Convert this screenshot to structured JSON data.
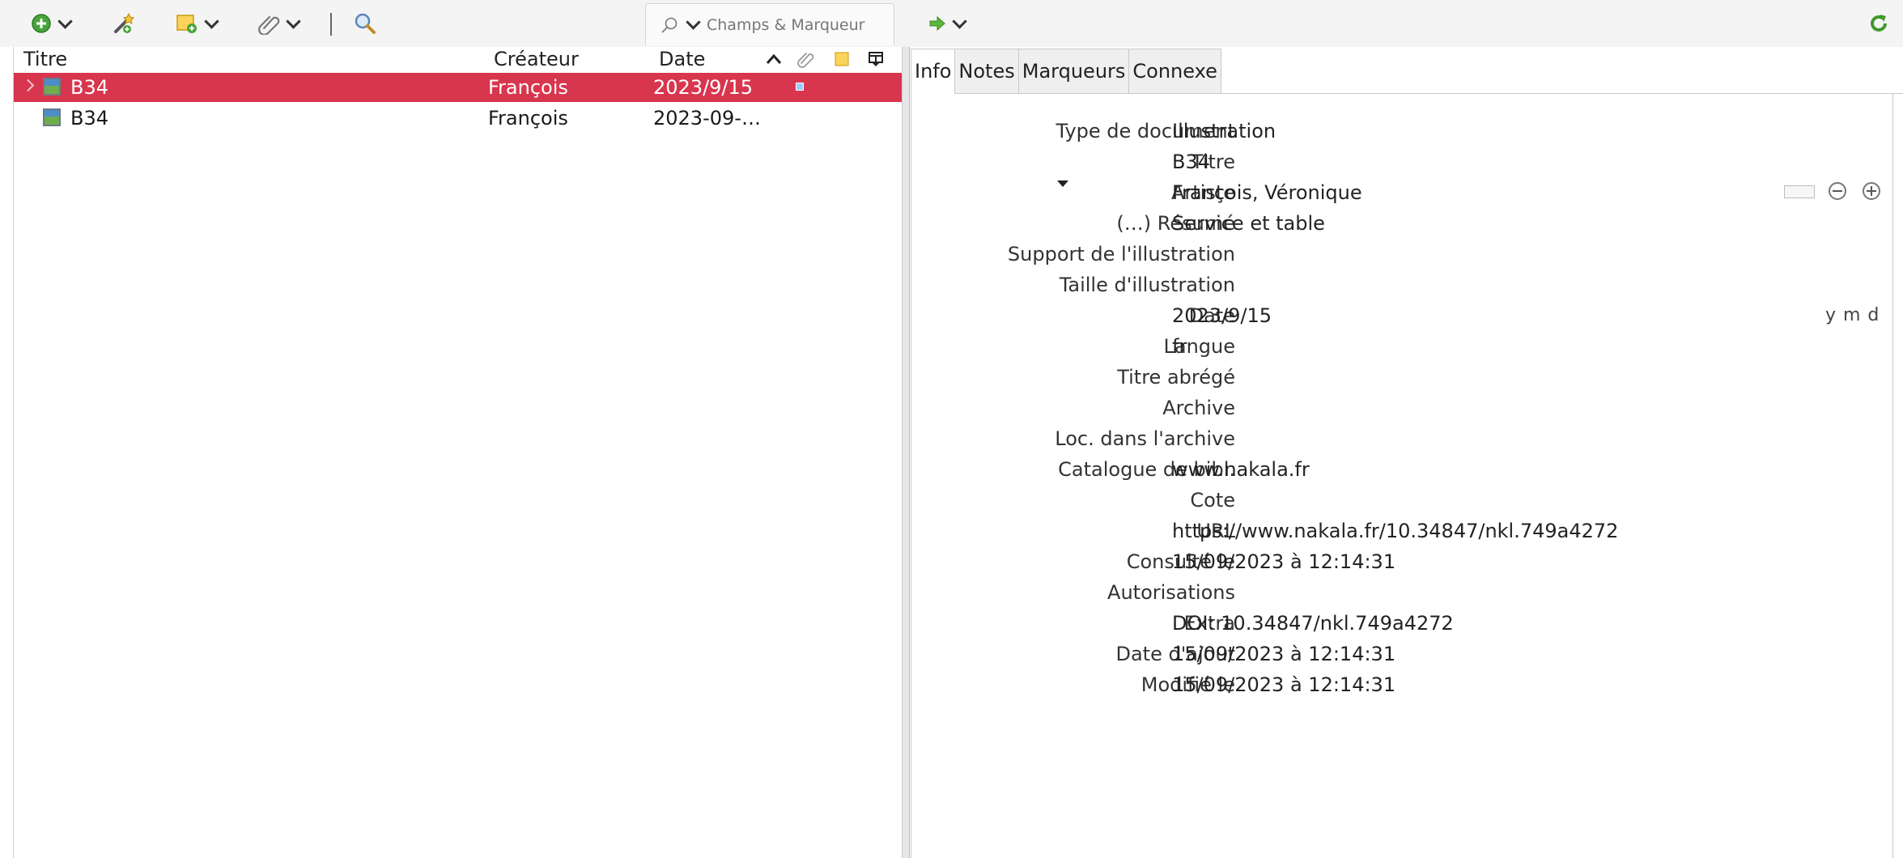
{
  "toolbar": {
    "search_placeholder": "Champs & Marqueur"
  },
  "items_list": {
    "columns": [
      "Titre",
      "Créateur",
      "Date"
    ],
    "rows": [
      {
        "title": "B34",
        "creator": "François",
        "date": "2023/9/15",
        "selected": true
      },
      {
        "title": "B34",
        "creator": "François",
        "date": "2023-09-…",
        "selected": false
      }
    ]
  },
  "item_pane": {
    "tabs": [
      "Info",
      "Notes",
      "Marqueurs",
      "Connexe"
    ],
    "active_tab": "Info",
    "fields": [
      {
        "label": "Type de document",
        "value": "Illustration"
      },
      {
        "label": "Titre",
        "value": "B34"
      },
      {
        "label": "Artiste",
        "value": "François, Véronique"
      },
      {
        "label": "(…) Résumé",
        "value": "Service et table"
      },
      {
        "label": "Support de l'illustration",
        "value": ""
      },
      {
        "label": "Taille d'illustration",
        "value": ""
      },
      {
        "label": "Date",
        "value": "2023/9/15"
      },
      {
        "label": "Langue",
        "value": "fr"
      },
      {
        "label": "Titre abrégé",
        "value": ""
      },
      {
        "label": "Archive",
        "value": ""
      },
      {
        "label": "Loc. dans l'archive",
        "value": ""
      },
      {
        "label": "Catalogue de bibl.",
        "value": "www.nakala.fr"
      },
      {
        "label": "Cote",
        "value": ""
      },
      {
        "label": "URL",
        "value": "https://www.nakala.fr/10.34847/nkl.749a4272"
      },
      {
        "label": "Consulté le",
        "value": "15/09/2023 à 12:14:31"
      },
      {
        "label": "Autorisations",
        "value": ""
      },
      {
        "label": "Extra",
        "value": "DOI: 10.34847/nkl.749a4272"
      },
      {
        "label": "Date d'ajout",
        "value": "15/09/2023 à 12:14:31"
      },
      {
        "label": "Modifié le",
        "value": "15/09/2023 à 12:14:31"
      }
    ],
    "date_format_hint": "y m d"
  },
  "colors": {
    "selection": "#d8364e",
    "toolbar_bg": "#f4f4f4"
  }
}
